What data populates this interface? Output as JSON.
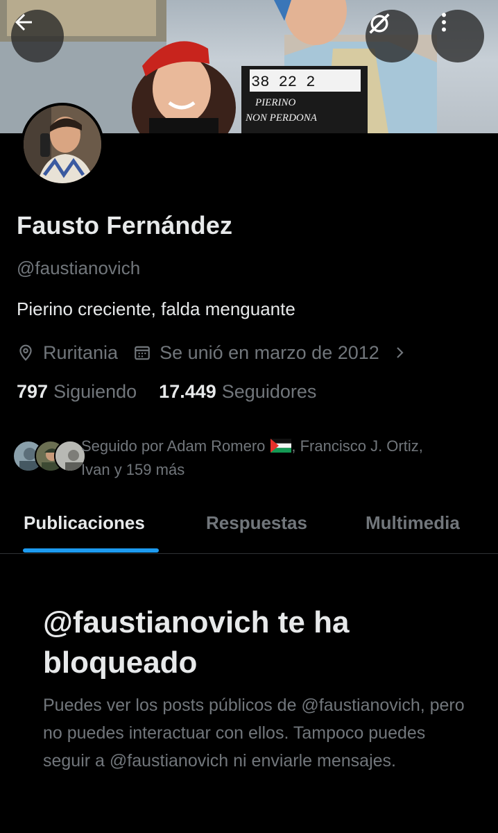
{
  "profile": {
    "name": "Fausto Fernández",
    "handle": "@faustianovich",
    "bio": "Pierino creciente, falda menguante",
    "location": "Ruritania",
    "joined": "Se unió en marzo de 2012",
    "following_count": "797",
    "following_label": "Siguiendo",
    "followers_count": "17.449",
    "followers_label": "Seguidores"
  },
  "followed_by": {
    "prefix": "Seguido por Adam Romero",
    "suffix": ", Francisco J. Ortiz,",
    "line2": "Ivan y 159 más"
  },
  "tabs": [
    {
      "label": "Publicaciones",
      "active": true
    },
    {
      "label": "Respuestas",
      "active": false
    },
    {
      "label": "Multimedia",
      "active": false
    }
  ],
  "blocked": {
    "title": "@faustianovich te ha bloqueado",
    "description": "Puedes ver los posts públicos de @faustianovich, pero no puedes interactuar con ellos. Tampoco puedes seguir a @faustianovich ni enviarle mensajes."
  },
  "banner_clapper": {
    "line1": "38   22   2",
    "line2": "PIERINO",
    "line3": "NON PERDONA"
  },
  "icons": {
    "back": "arrow-left-icon",
    "hide": "eye-slash-icon",
    "more": "more-vertical-icon",
    "location": "location-pin-icon",
    "calendar": "calendar-icon",
    "chevron": "chevron-right-icon",
    "flag": "palestine-flag-icon"
  },
  "colors": {
    "background": "#000000",
    "text_primary": "#e7e9ea",
    "text_secondary": "#71767b",
    "accent": "#1d9bf0",
    "divider": "#2f3336"
  }
}
